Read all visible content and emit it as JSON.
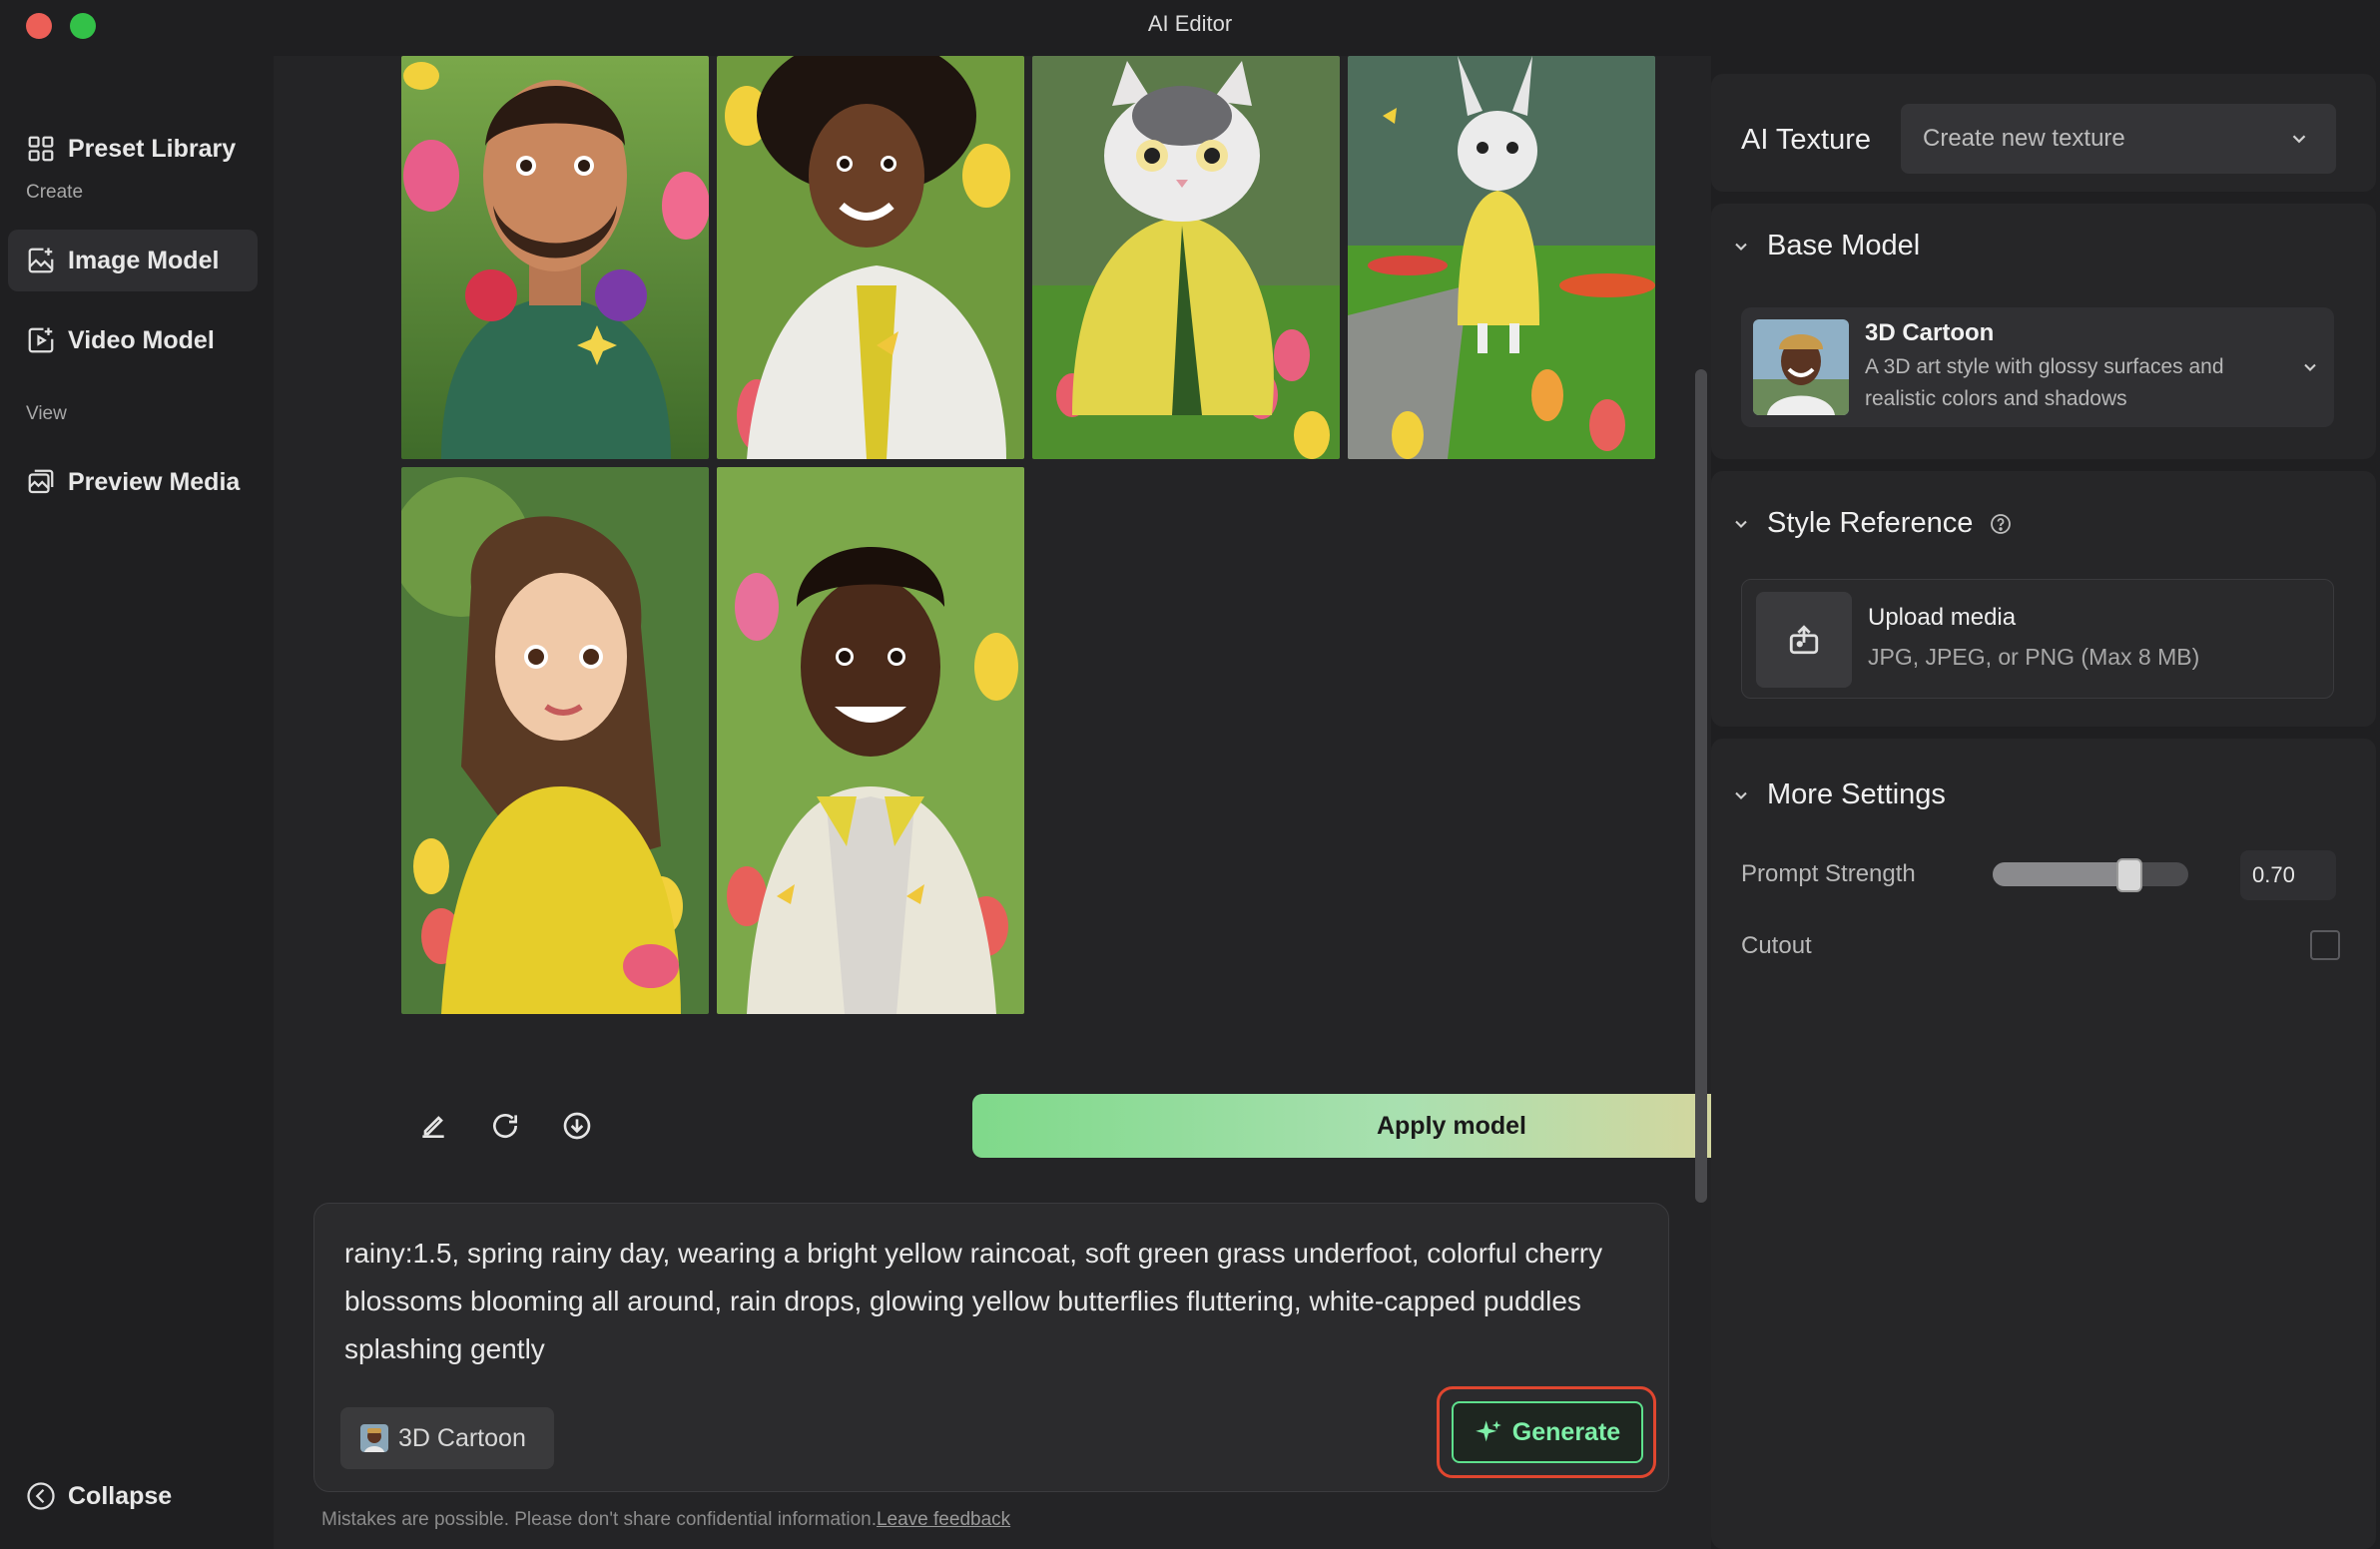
{
  "window": {
    "title": "AI Editor"
  },
  "sidebar": {
    "preset_library": "Preset Library",
    "section_create": "Create",
    "image_model": "Image Model",
    "video_model": "Video Model",
    "section_view": "View",
    "preview_media": "Preview Media",
    "collapse": "Collapse"
  },
  "gallery": {
    "images": [
      {
        "subject": "bearded man in green hoodie with headphones"
      },
      {
        "subject": "woman with afro in white jacket"
      },
      {
        "subject": "cat in yellow raincoat among tulips"
      },
      {
        "subject": "rabbit in yellow raincoat in rain"
      },
      {
        "subject": "long-haired woman in yellow raincoat"
      },
      {
        "subject": "smiling man in cream jacket"
      }
    ]
  },
  "toolbar": {
    "apply_label": "Apply model"
  },
  "prompt": {
    "text": "rainy:1.5, spring rainy day, wearing a bright yellow raincoat, soft green grass underfoot, colorful cherry blossoms blooming all around, rain drops, glowing yellow butterflies fluttering, white-capped puddles splashing gently",
    "model_chip": "3D Cartoon",
    "generate_label": "Generate"
  },
  "footer": {
    "disclaimer": "Mistakes are possible. Please don't share confidential information.",
    "feedback_link": "Leave feedback"
  },
  "panel": {
    "ai_texture_title": "AI Texture",
    "texture_select": "Create new texture",
    "base_model": {
      "heading": "Base Model",
      "name": "3D Cartoon",
      "description_line1": "A 3D art style with glossy surfaces and",
      "description_line2": "realistic colors and shadows"
    },
    "style_reference": {
      "heading": "Style Reference",
      "upload_title": "Upload media",
      "upload_hint": "JPG, JPEG, or PNG (Max 8 MB)"
    },
    "more_settings": {
      "heading": "More Settings",
      "prompt_strength_label": "Prompt Strength",
      "prompt_strength_value": "0.70",
      "prompt_strength_fraction": 0.7,
      "cutout_label": "Cutout",
      "cutout_checked": false
    }
  },
  "colors": {
    "accent_green": "#5ee08d",
    "highlight_red": "#e0462f"
  }
}
